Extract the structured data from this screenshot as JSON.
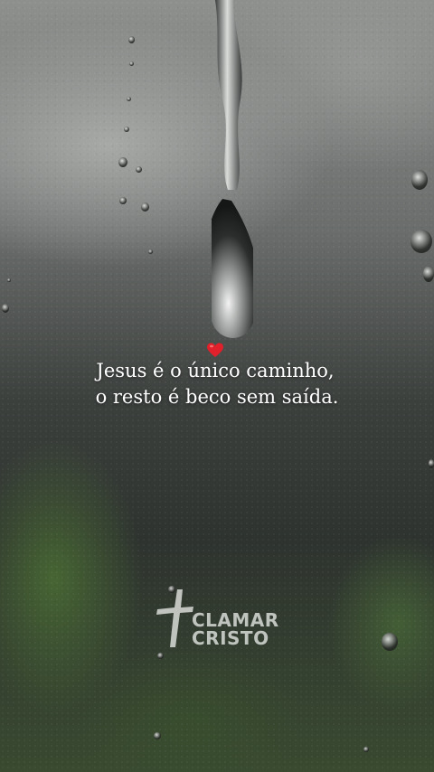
{
  "quote": {
    "line1": "Jesus é o único caminho,",
    "line2": "o resto é beco sem saída."
  },
  "emoji": {
    "name": "red-heart",
    "color": "#e0202a"
  },
  "logo": {
    "line1": "CLAMAR",
    "line2": "CRISTO",
    "icon": "cross-icon",
    "color": "#d9dcd8"
  }
}
